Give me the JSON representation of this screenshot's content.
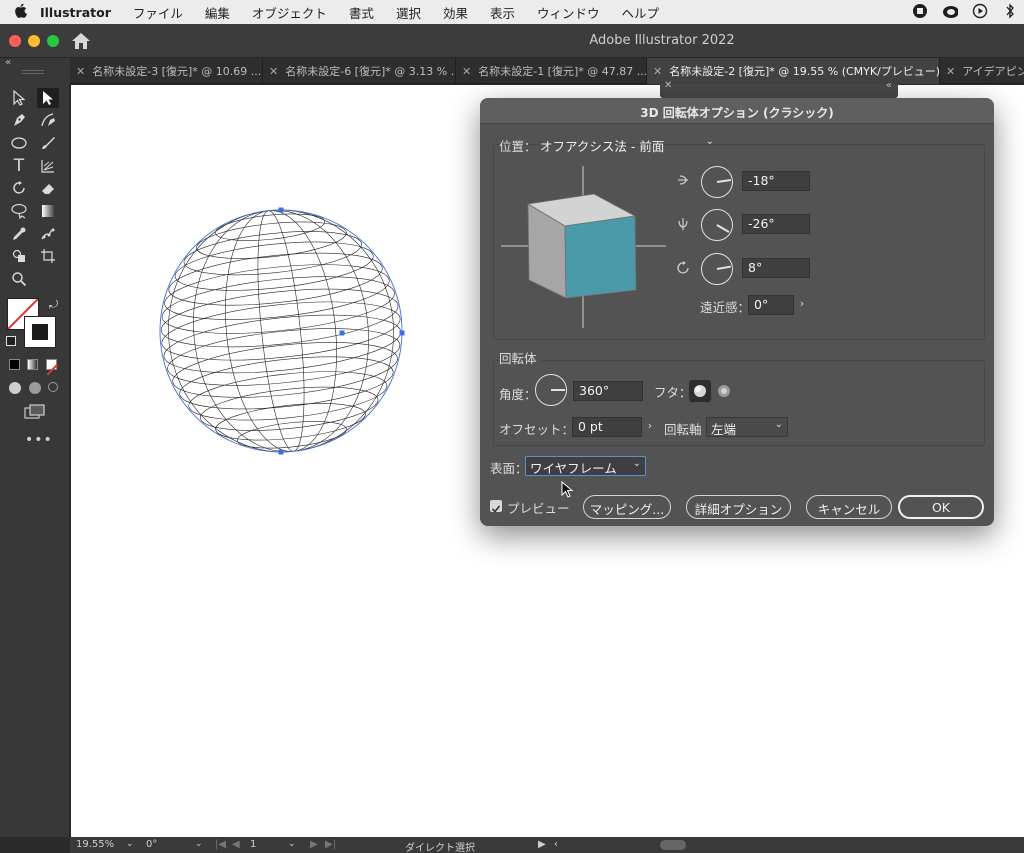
{
  "menubar": {
    "app_name": "Illustrator",
    "items": [
      "ファイル",
      "編集",
      "オブジェクト",
      "書式",
      "選択",
      "効果",
      "表示",
      "ウィンドウ",
      "ヘルプ"
    ]
  },
  "window": {
    "title": "Adobe Illustrator 2022"
  },
  "tabs": [
    {
      "label": "名称未設定-3 [復元]* @ 10.69 ..."
    },
    {
      "label": "名称未設定-6 [復元]* @ 3.13 % ..."
    },
    {
      "label": "名称未設定-1 [復元]* @ 47.87 ..."
    },
    {
      "label": "名称未設定-2 [復元]* @ 19.55 % (CMYK/プレビュー)"
    },
    {
      "label": "アイデアピン"
    }
  ],
  "dialog": {
    "title": "3D 回転体オプション (クラシック)",
    "position": {
      "label": "位置：",
      "value": "オフアクシス法 - 前面",
      "x_rotation": "-18°",
      "y_rotation": "-26°",
      "z_rotation": "8°",
      "perspective_label": "遠近感：",
      "perspective_value": "0°"
    },
    "revolve": {
      "section_label": "回転体",
      "angle_label": "角度：",
      "angle_value": "360°",
      "cap_label": "フタ：",
      "offset_label": "オフセット：",
      "offset_value": "0 pt",
      "axis_label": "回転軸",
      "axis_value": "左端"
    },
    "surface": {
      "label": "表面：",
      "value": "ワイヤフレーム"
    },
    "buttons": {
      "preview_label": "プレビュー",
      "mapping_label": "マッピング...",
      "more_options_label": "詳細オプション",
      "cancel_label": "キャンセル",
      "ok_label": "OK"
    },
    "cube_colors": {
      "front": "#4a9aaa",
      "top": "#d3d3d3",
      "side": "#a6a6a6"
    }
  },
  "statusbar": {
    "zoom": "19.55%",
    "rotation": "0°",
    "artboard": "1",
    "tool": "ダイレクト選択"
  },
  "icons": [
    "apple-icon",
    "home-icon",
    "selection-tool-icon",
    "direct-selection-tool-icon",
    "pen-tool-icon",
    "type-tool-icon",
    "ellipse-tool-icon",
    "eraser-tool-icon",
    "gradient-tool-icon",
    "eyedropper-tool-icon",
    "zoom-tool-icon"
  ]
}
